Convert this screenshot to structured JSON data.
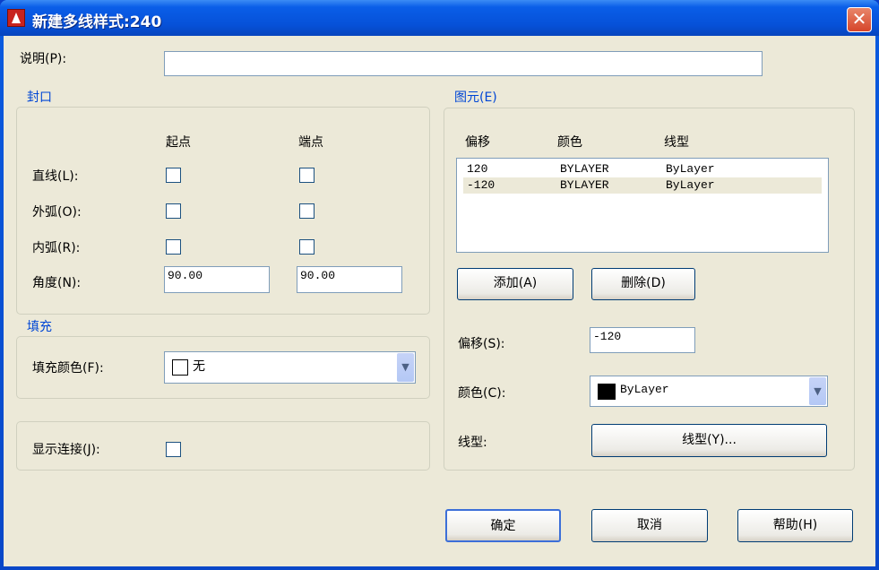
{
  "window": {
    "title": "新建多线样式:240",
    "close": "✕"
  },
  "description": {
    "label": "说明(P):",
    "value": ""
  },
  "caps": {
    "legend": "封口",
    "col_start": "起点",
    "col_end": "端点",
    "rows": [
      {
        "label": "直线(L):",
        "start": false,
        "end": false
      },
      {
        "label": "外弧(O):",
        "start": false,
        "end": false
      },
      {
        "label": "内弧(R):",
        "start": false,
        "end": false
      }
    ],
    "angle": {
      "label": "角度(N):",
      "start": "90.00",
      "end": "90.00"
    }
  },
  "fill": {
    "legend": "填充",
    "color_label": "填充颜色(F):",
    "color_value": "无"
  },
  "joints": {
    "label": "显示连接(J):",
    "checked": false
  },
  "elements": {
    "legend": "图元(E)",
    "headers": [
      "偏移",
      "颜色",
      "线型"
    ],
    "rows": [
      {
        "offset": "120",
        "color": "BYLAYER",
        "linetype": "ByLayer"
      },
      {
        "offset": "-120",
        "color": "BYLAYER",
        "linetype": "ByLayer"
      }
    ],
    "add": "添加(A)",
    "delete": "删除(D)",
    "offset_label": "偏移(S):",
    "offset_value": "-120",
    "color_label": "颜色(C):",
    "color_value": "ByLayer",
    "color_swatch": "#000000",
    "linetype_label": "线型:",
    "linetype_button": "线型(Y)..."
  },
  "buttons": {
    "ok": "确定",
    "cancel": "取消",
    "help": "帮助(H)"
  }
}
